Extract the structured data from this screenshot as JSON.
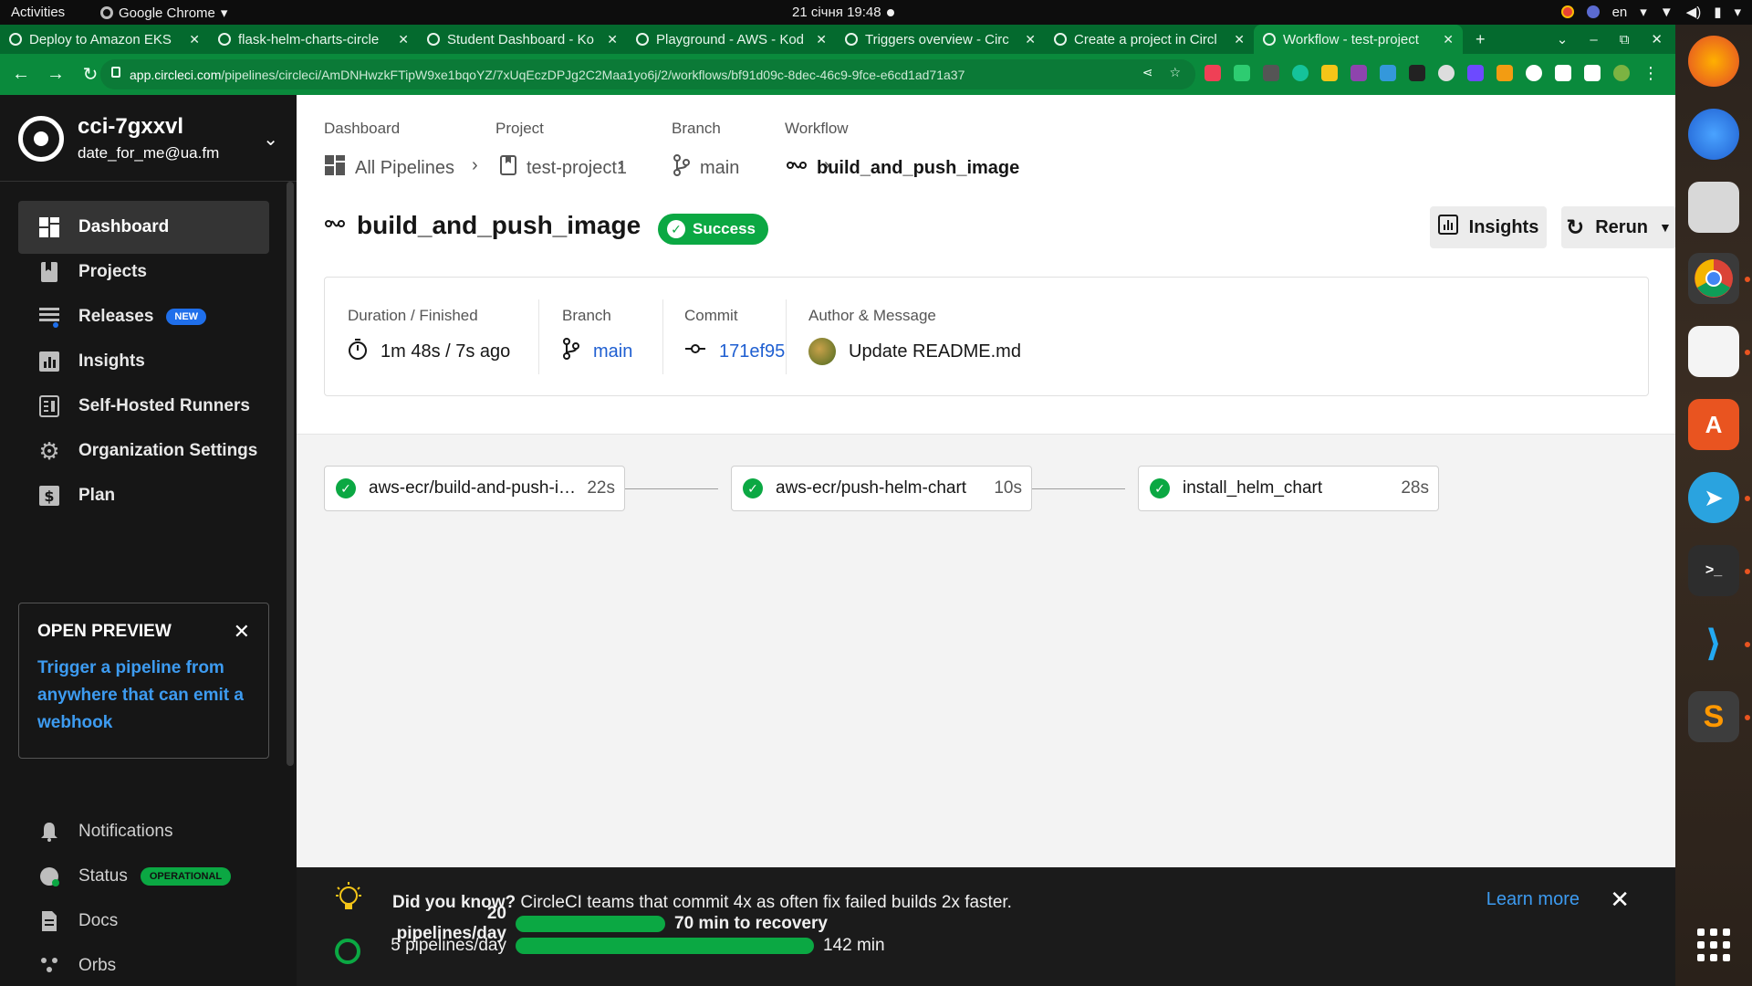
{
  "gnome": {
    "activities": "Activities",
    "app_name": "Google Chrome",
    "clock": "21 січня  19:48",
    "lang": "en"
  },
  "tabs": [
    {
      "title": "Deploy to Amazon EKS"
    },
    {
      "title": "flask-helm-charts-circle"
    },
    {
      "title": "Student Dashboard - Ko"
    },
    {
      "title": "Playground - AWS - Kod"
    },
    {
      "title": "Triggers overview - Circ"
    },
    {
      "title": "Create a project in Circl"
    },
    {
      "title": "Workflow - test-project"
    }
  ],
  "omnibox": {
    "host": "app.circleci.com",
    "path": "/pipelines/circleci/AmDNHwzkFTipW9xe1bqoYZ/7xUqEczDPJg2C2Maa1yo6j/2/workflows/bf91d09c-8dec-46c9-9fce-e6cd1ad71a37"
  },
  "sidebar": {
    "org_name": "cci-7gxxvl",
    "org_email": "date_for_me@ua.fm",
    "items": [
      {
        "label": "Dashboard"
      },
      {
        "label": "Projects"
      },
      {
        "label": "Releases",
        "badge": "NEW"
      },
      {
        "label": "Insights"
      },
      {
        "label": "Self-Hosted Runners"
      },
      {
        "label": "Organization Settings"
      },
      {
        "label": "Plan"
      }
    ],
    "preview": {
      "heading": "OPEN PREVIEW",
      "link": "Trigger a pipeline from anywhere that can emit a webhook"
    },
    "bottom_items": [
      {
        "label": "Notifications"
      },
      {
        "label": "Status",
        "badge": "OPERATIONAL"
      },
      {
        "label": "Docs"
      },
      {
        "label": "Orbs"
      }
    ]
  },
  "breadcrumb": {
    "labels": [
      "Dashboard",
      "Project",
      "Branch",
      "Workflow"
    ],
    "values": [
      "All Pipelines",
      "test-project1",
      "main",
      "build_and_push_image"
    ]
  },
  "workflow": {
    "title": "build_and_push_image",
    "status": "Success",
    "insights_label": "Insights",
    "rerun_label": "Rerun",
    "more_label": "•••"
  },
  "summary": {
    "duration_label": "Duration / Finished",
    "duration_value": "1m 48s / 7s ago",
    "branch_label": "Branch",
    "branch_value": "main",
    "commit_label": "Commit",
    "commit_value": "171ef95",
    "author_label": "Author & Message",
    "author_message": "Update README.md"
  },
  "jobs": [
    {
      "name": "aws-ecr/build-and-push-image",
      "duration": "22s"
    },
    {
      "name": "aws-ecr/push-helm-chart",
      "duration": "10s"
    },
    {
      "name": "install_helm_chart",
      "duration": "28s"
    }
  ],
  "banner": {
    "tip_bold": "Did you know?",
    "tip_text": " CircleCI teams that commit 4x as often fix failed builds 2x faster.",
    "learn_more": "Learn more",
    "row1_label": "20 pipelines/day",
    "row1_after": "70 min to recovery",
    "row1_fraction": 0.3,
    "row2_label": "5 pipelines/day",
    "row2_after": "142 min",
    "row2_fraction": 0.6
  },
  "colors": {
    "chrome_green": "#0a8a3c",
    "success": "#0ba843",
    "link": "#1f5fd1"
  }
}
